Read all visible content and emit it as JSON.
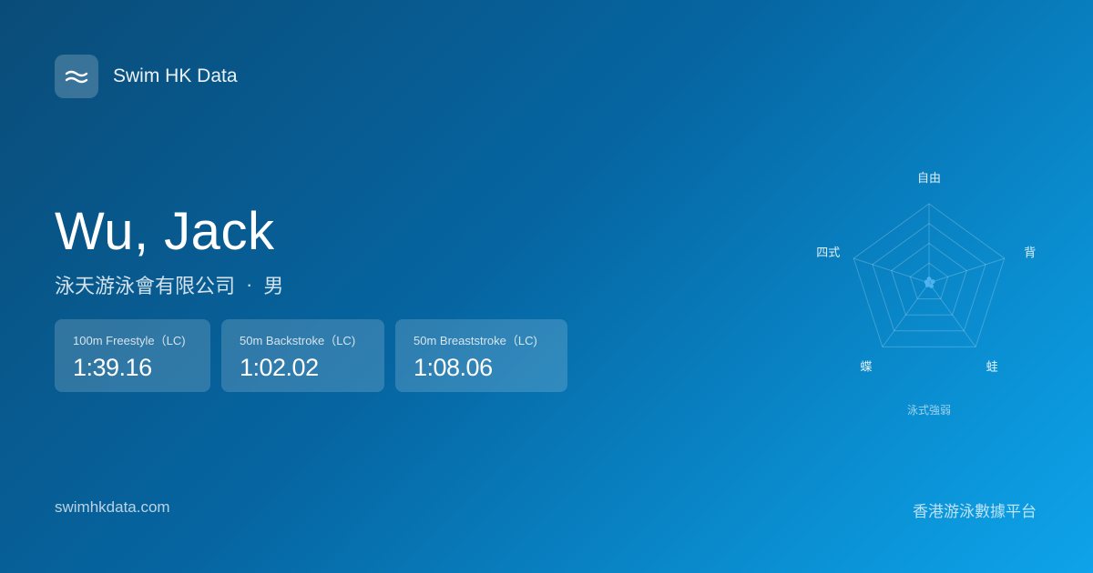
{
  "brand": {
    "name": "Swim HK Data",
    "logo_icon": "waves-icon"
  },
  "swimmer": {
    "name": "Wu, Jack",
    "club": "泳天游泳會有限公司",
    "separator": "·",
    "gender": "男"
  },
  "best_times": [
    {
      "event": "100m Freestyle（LC)",
      "time": "1:39.16"
    },
    {
      "event": "50m Backstroke（LC)",
      "time": "1:02.02"
    },
    {
      "event": "50m Breaststroke（LC)",
      "time": "1:08.06"
    }
  ],
  "chart_data": {
    "type": "radar",
    "title": "",
    "caption": "泳式強弱",
    "axes": [
      "自由",
      "背",
      "蛙",
      "蝶",
      "四式"
    ],
    "values": [
      0.05,
      0.05,
      0.05,
      0.0,
      0.0
    ],
    "range": [
      0,
      1
    ],
    "rings": 4,
    "accent_color": "#4fb3f0"
  },
  "footer": {
    "site": "swimhkdata.com",
    "tagline": "香港游泳數據平台"
  },
  "colors": {
    "background_start": "#0a4c78",
    "background_end": "#0ea3ea"
  }
}
